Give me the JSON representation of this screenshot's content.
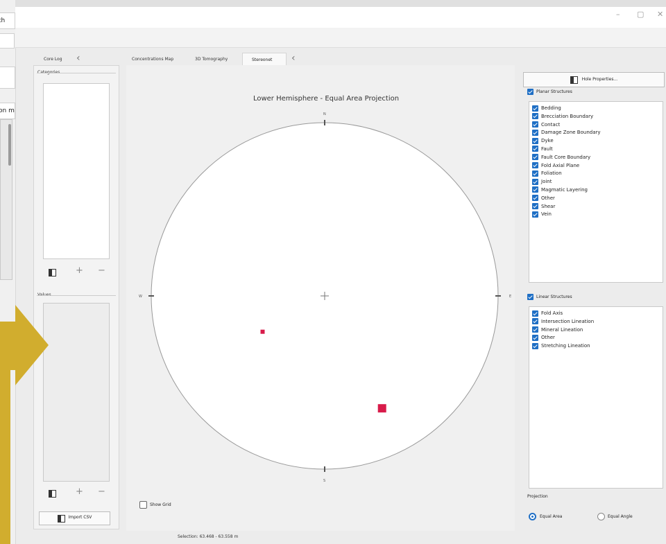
{
  "background_window": {
    "field1": "th",
    "field2": "on m"
  },
  "window": {
    "minimize": "–",
    "maximize": "▢",
    "close": "✕"
  },
  "left_panel": {
    "tab": "Core Log",
    "categories_label": "Categories",
    "values_label": "Values",
    "add": "+",
    "remove": "−",
    "import_csv": "Import CSV"
  },
  "tabs": [
    "Concentrations Map",
    "3D Tomography",
    "Stereonet"
  ],
  "stereonet": {
    "title": "Lower Hemisphere - Equal Area Projection",
    "north": "N",
    "south": "S",
    "east": "E",
    "west": "W",
    "show_grid": "Show Grid",
    "points": [
      {
        "trend": 240,
        "plunge": 56,
        "size": "small",
        "color": "#d81b4a"
      },
      {
        "trend": 153,
        "plunge": 28,
        "size": "large",
        "color": "#d81b4a"
      }
    ]
  },
  "right_panel": {
    "hole_properties": "Hole Properties...",
    "planar_label": "Planar Structures",
    "planar_items": [
      "Bedding",
      "Brecciation Boundary",
      "Contact",
      "Damage Zone Boundary",
      "Dyke",
      "Fault",
      "Fault Core Boundary",
      "Fold Axial Plane",
      "Foliation",
      "Joint",
      "Magmatic Layering",
      "Other",
      "Shear",
      "Vein"
    ],
    "linear_label": "Linear Structures",
    "linear_items": [
      "Fold Axis",
      "Intersection Lineation",
      "Mineral Lineation",
      "Other",
      "Stretching Lineation"
    ],
    "projection_label": "Projection",
    "equal_area": "Equal Area",
    "equal_angle": "Equal Angle"
  },
  "status_bar": {
    "selection": "Selection: 63.468 - 63.558 m"
  },
  "colors": {
    "accent": "#1f6fc5",
    "pole_marker": "#d81b4a",
    "arrow": "#d1ad2e"
  }
}
